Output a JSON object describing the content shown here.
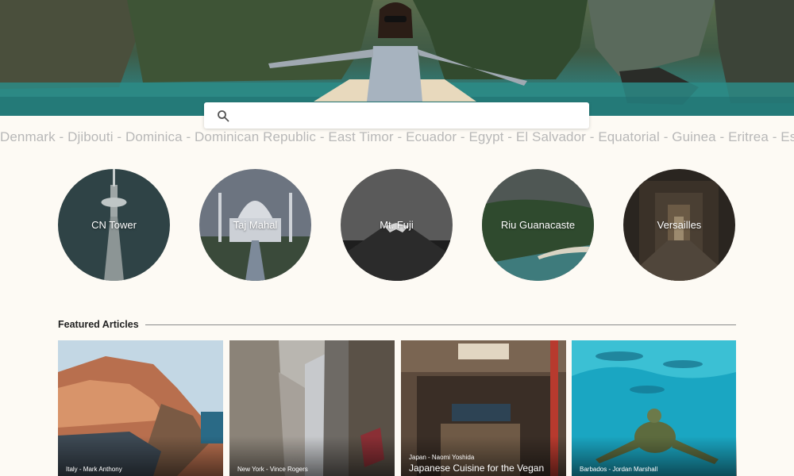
{
  "search": {
    "placeholder": "",
    "icon": "search-icon"
  },
  "countries_ticker": "Denmark - Djibouti - Dominica - Dominican Republic - East Timor - Ecuador - Egypt - El Salvador - Equatorial - Guinea - Eritrea - Estonia",
  "destinations": [
    {
      "label": "CN Tower"
    },
    {
      "label": "Taj Mahal"
    },
    {
      "label": "Mt. Fuji"
    },
    {
      "label": "Riu Guanacaste"
    },
    {
      "label": "Versailles"
    }
  ],
  "featured": {
    "heading": "Featured Articles",
    "articles": [
      {
        "meta": "Italy - Mark Anthony",
        "title": ""
      },
      {
        "meta": "New York - Vince Rogers",
        "title": ""
      },
      {
        "meta": "Japan - Naomi Yoshida",
        "title": "Japanese Cuisine for the Vegan"
      },
      {
        "meta": "Barbados - Jordan Marshall",
        "title": ""
      }
    ]
  },
  "colors": {
    "background": "#fdfaf4",
    "ticker_text": "#b8b8b8",
    "heading_text": "#222222"
  }
}
